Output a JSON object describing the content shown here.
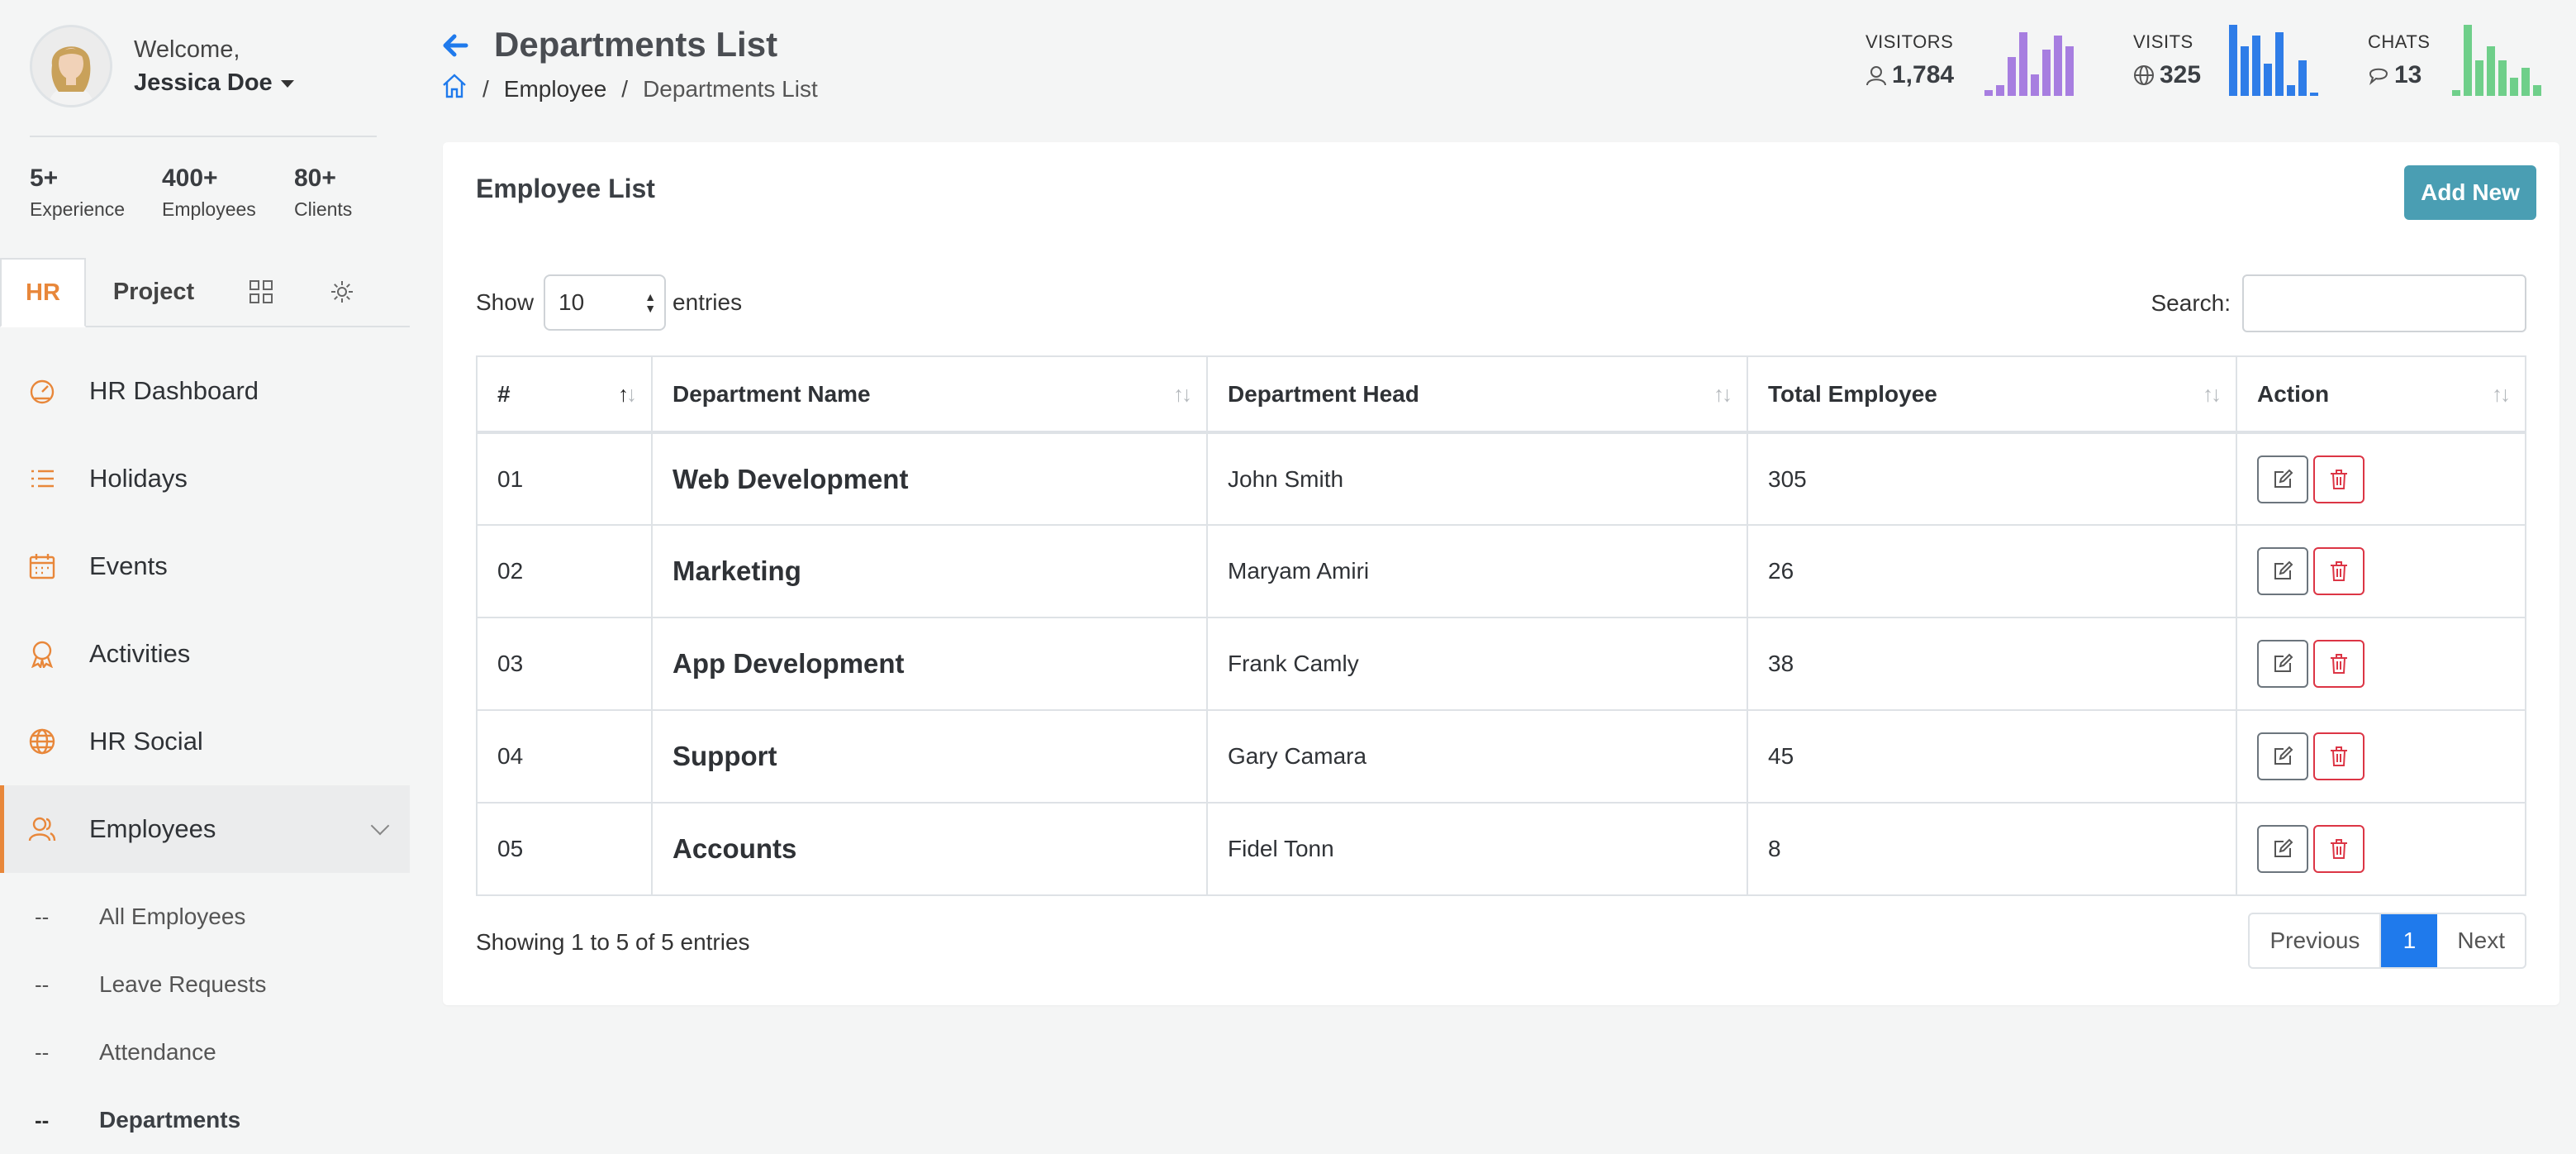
{
  "user": {
    "greeting": "Welcome,",
    "name": "Jessica Doe"
  },
  "stats": [
    {
      "value": "5+",
      "label": "Experience"
    },
    {
      "value": "400+",
      "label": "Employees"
    },
    {
      "value": "80+",
      "label": "Clients"
    }
  ],
  "tabs": {
    "hr": "HR",
    "project": "Project"
  },
  "menu": [
    {
      "label": "HR Dashboard",
      "icon": "speedometer-icon"
    },
    {
      "label": "Holidays",
      "icon": "list-icon"
    },
    {
      "label": "Events",
      "icon": "calendar-icon"
    },
    {
      "label": "Activities",
      "icon": "award-icon"
    },
    {
      "label": "HR Social",
      "icon": "globe-icon"
    },
    {
      "label": "Employees",
      "icon": "users-icon",
      "active": true
    }
  ],
  "submenu": [
    {
      "dash": "--",
      "label": "All Employees"
    },
    {
      "dash": "--",
      "label": "Leave Requests"
    },
    {
      "dash": "--",
      "label": "Attendance"
    },
    {
      "dash": "--",
      "label": "Departments",
      "active": true
    }
  ],
  "header": {
    "title": "Departments List",
    "breadcrumb": {
      "home_icon": "home-icon",
      "sep": "/",
      "section": "Employee",
      "current": "Departments List"
    }
  },
  "metrics": [
    {
      "label": "VISITORS",
      "value": "1,784",
      "icon": "user-icon",
      "color": "#a77ee0",
      "bars": [
        0.08,
        0.15,
        0.55,
        0.9,
        0.3,
        0.65,
        0.85,
        0.7
      ]
    },
    {
      "label": "VISITS",
      "value": "325",
      "icon": "globe-icon",
      "color": "#2f7de8",
      "bars": [
        1.0,
        0.7,
        0.85,
        0.45,
        0.9,
        0.15,
        0.5,
        0.05
      ]
    },
    {
      "label": "CHATS",
      "value": "13",
      "icon": "chat-icon",
      "color": "#6fcf8a",
      "bars": [
        0.08,
        1.0,
        0.5,
        0.7,
        0.5,
        0.25,
        0.4,
        0.15
      ]
    }
  ],
  "card": {
    "title": "Employee List",
    "add_button": "Add New",
    "show_label": "Show",
    "entries_value": "10",
    "entries_label": "entries",
    "search_label": "Search:",
    "search_value": ""
  },
  "table": {
    "columns": [
      "#",
      "Department Name",
      "Department Head",
      "Total Employee",
      "Action"
    ],
    "rows": [
      {
        "num": "01",
        "dept": "Web Development",
        "head": "John Smith",
        "total": "305"
      },
      {
        "num": "02",
        "dept": "Marketing",
        "head": "Maryam Amiri",
        "total": "26"
      },
      {
        "num": "03",
        "dept": "App Development",
        "head": "Frank Camly",
        "total": "38"
      },
      {
        "num": "04",
        "dept": "Support",
        "head": "Gary Camara",
        "total": "45"
      },
      {
        "num": "05",
        "dept": "Accounts",
        "head": "Fidel Tonn",
        "total": "8"
      }
    ]
  },
  "footer": {
    "info": "Showing 1 to 5 of 5 entries",
    "prev": "Previous",
    "page": "1",
    "next": "Next"
  },
  "colors": {
    "accent": "#e8873a",
    "primary": "#1f7aec",
    "add_button": "#4a9eb3",
    "danger": "#dc3545"
  }
}
